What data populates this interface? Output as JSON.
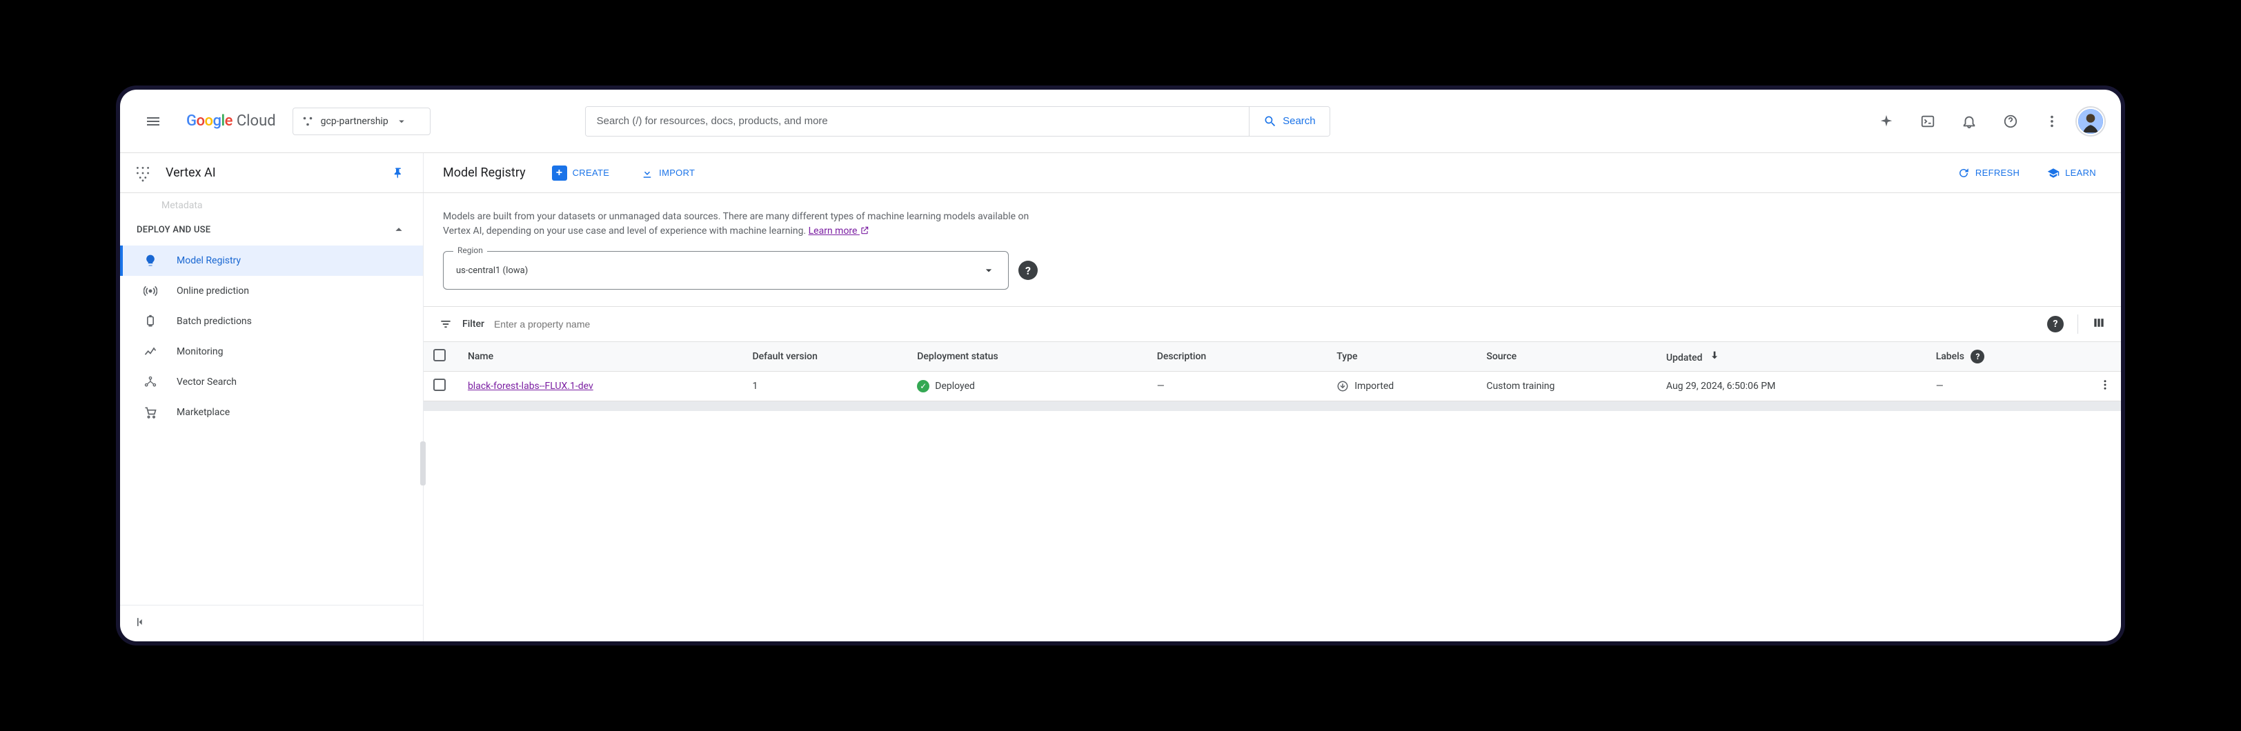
{
  "header": {
    "brand_google": "Google",
    "brand_cloud": "Cloud",
    "project_name": "gcp-partnership",
    "search_placeholder": "Search (/) for resources, docs, products, and more",
    "search_button": "Search"
  },
  "product": {
    "name": "Vertex AI"
  },
  "page": {
    "title": "Model Registry",
    "create_label": "CREATE",
    "import_label": "IMPORT",
    "refresh_label": "REFRESH",
    "learn_label": "LEARN"
  },
  "sidebar": {
    "truncated_top": "Metadata",
    "section_title": "DEPLOY AND USE",
    "items": [
      {
        "label": "Model Registry",
        "icon": "lightbulb",
        "active": true
      },
      {
        "label": "Online prediction",
        "icon": "broadcast",
        "active": false
      },
      {
        "label": "Batch predictions",
        "icon": "batch",
        "active": false
      },
      {
        "label": "Monitoring",
        "icon": "monitoring",
        "active": false
      },
      {
        "label": "Vector Search",
        "icon": "graph",
        "active": false
      },
      {
        "label": "Marketplace",
        "icon": "cart",
        "active": false
      }
    ]
  },
  "intro": {
    "text": "Models are built from your datasets or unmanaged data sources. There are many different types of machine learning models available on Vertex AI, depending on your use case and level of experience with machine learning. ",
    "learn_more": "Learn more"
  },
  "region": {
    "label": "Region",
    "value": "us-central1 (Iowa)"
  },
  "filter": {
    "label": "Filter",
    "placeholder": "Enter a property name"
  },
  "table": {
    "columns": {
      "name": "Name",
      "default_version": "Default version",
      "deployment_status": "Deployment status",
      "description": "Description",
      "type": "Type",
      "source": "Source",
      "updated": "Updated",
      "labels": "Labels"
    },
    "rows": [
      {
        "name": "black-forest-labs--FLUX.1-dev",
        "default_version": "1",
        "deployment_status": "Deployed",
        "description": "—",
        "type": "Imported",
        "source": "Custom training",
        "updated": "Aug 29, 2024, 6:50:06 PM",
        "labels": "—"
      }
    ]
  }
}
